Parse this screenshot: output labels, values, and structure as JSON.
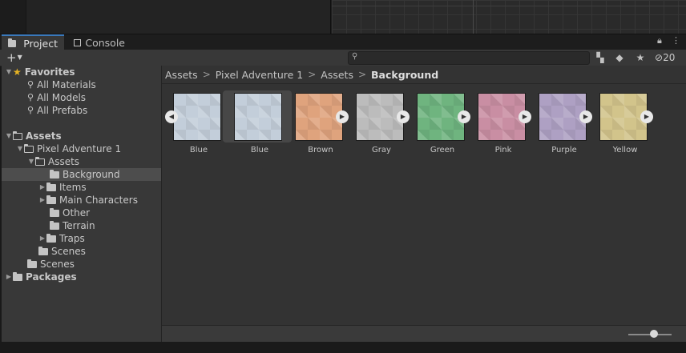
{
  "tabs": {
    "project": "Project",
    "console": "Console"
  },
  "toolbar": {
    "add": "+",
    "search_placeholder": "",
    "hidden_packages_count": "20",
    "icons": [
      "scene-filter-icon",
      "label-icon",
      "favorite-star-icon",
      "eye-hidden-icon"
    ]
  },
  "sidebar": {
    "favorites": "Favorites",
    "fav_items": [
      "All Materials",
      "All Models",
      "All Prefabs"
    ],
    "assets": "Assets",
    "pixel_adventure": "Pixel Adventure 1",
    "sub_assets": "Assets",
    "background": "Background",
    "items": "Items",
    "main_characters": "Main Characters",
    "other": "Other",
    "terrain": "Terrain",
    "traps": "Traps",
    "scenes_inner": "Scenes",
    "scenes": "Scenes",
    "packages": "Packages"
  },
  "breadcrumb": [
    "Assets",
    "Pixel Adventure 1",
    "Assets",
    "Background"
  ],
  "assets_grid": [
    {
      "name": "Blue",
      "color": "#c3ceda",
      "arrow": "◀"
    },
    {
      "name": "Blue",
      "color": "#c3ceda",
      "arrow": ""
    },
    {
      "name": "Brown",
      "color": "#dfa37d",
      "arrow": "▶"
    },
    {
      "name": "Gray",
      "color": "#bcbcbc",
      "arrow": "▶"
    },
    {
      "name": "Green",
      "color": "#6fb47f",
      "arrow": "▶"
    },
    {
      "name": "Pink",
      "color": "#c98ea3",
      "arrow": "▶"
    },
    {
      "name": "Purple",
      "color": "#aea0c3",
      "arrow": "▶"
    },
    {
      "name": "Yellow",
      "color": "#d2c48b",
      "arrow": "▶"
    }
  ],
  "zoom_slider_value": 0.6
}
